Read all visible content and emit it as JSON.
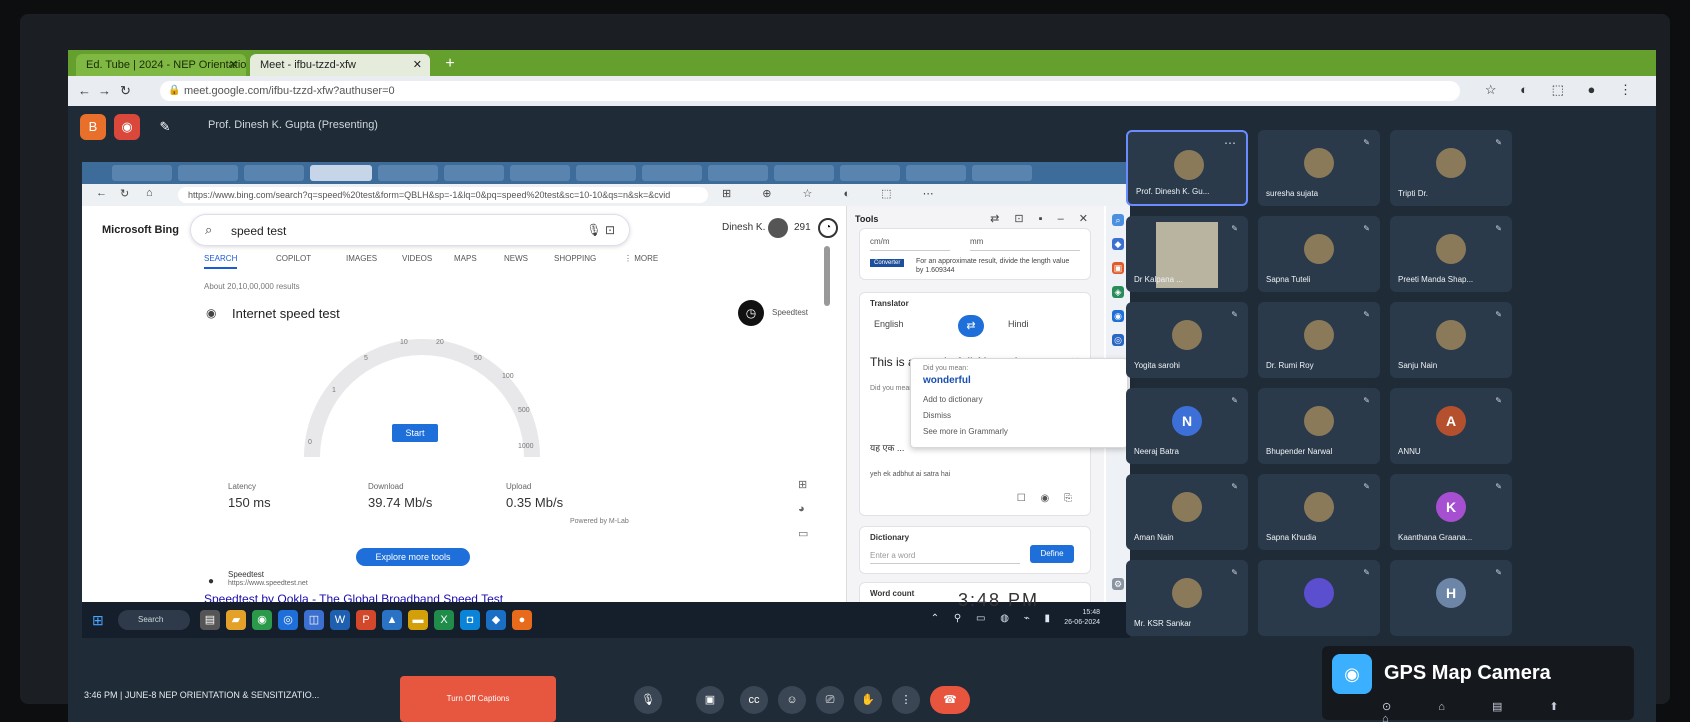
{
  "browser": {
    "tabs": [
      {
        "label": "Ed. Tube | 2024 - NEP Orientation"
      },
      {
        "label": "Meet - ifbu-tzzd-xfw"
      }
    ],
    "url": "meet.google.com/ifbu-tzzd-xfw?authuser=0",
    "new_tab": "+"
  },
  "meet": {
    "presenter_label": "Prof. Dinesh K. Gupta (Presenting)",
    "meeting_info": "3:46 PM  |  JUNE-8 NEP ORIENTATION & SENSITIZATIO...",
    "orange_button": "Turn Off Captions",
    "participants": [
      {
        "name": "Prof. Dinesh K. Gu...",
        "type": "photo"
      },
      {
        "name": "suresha sujata",
        "type": "photo"
      },
      {
        "name": "Tripti Dr.",
        "type": "photo"
      },
      {
        "name": "Dr Kalpana ...",
        "type": "camera"
      },
      {
        "name": "Sapna Tuteli",
        "type": "photo"
      },
      {
        "name": "Preeti Manda Shap...",
        "type": "photo"
      },
      {
        "name": "Yogita sarohi",
        "type": "photo"
      },
      {
        "name": "Dr. Rumi Roy",
        "type": "photo"
      },
      {
        "name": "Sanju Nain",
        "type": "photo"
      },
      {
        "name": "Neeraj Batra",
        "type": "letter",
        "letter": "N",
        "color": "#3c6fd8"
      },
      {
        "name": "Bhupender Narwal",
        "type": "photo"
      },
      {
        "name": "ANNU",
        "type": "letter",
        "letter": "A",
        "color": "#b5502e"
      },
      {
        "name": "Aman Nain",
        "type": "photo"
      },
      {
        "name": "Sapna Khudia",
        "type": "photo"
      },
      {
        "name": "Kaanthana Graana...",
        "type": "letter",
        "letter": "K",
        "color": "#a64fd0"
      },
      {
        "name": "Mr. KSR Sankar",
        "type": "photo"
      },
      {
        "name": "",
        "type": "letter",
        "letter": "",
        "color": "#5b4fd0"
      },
      {
        "name": "",
        "type": "letter",
        "letter": "H",
        "color": "#6d86a8"
      }
    ]
  },
  "shared": {
    "edge_url": "https://www.bing.com/search?q=speed%20test&form=QBLH&sp=-1&lq=0&pq=speed%20test&sc=10-10&qs=n&sk=&cvid",
    "bing": {
      "logo": "Microsoft Bing",
      "query": "speed test",
      "user": "Dinesh K.",
      "points": "291",
      "tabs": [
        "SEARCH",
        "COPILOT",
        "IMAGES",
        "VIDEOS",
        "MAPS",
        "NEWS",
        "SHOPPING",
        "⋮ MORE"
      ],
      "result_count": "About 20,10,00,000 results",
      "widget_title": "Internet speed test",
      "widget_badge": "Speedtest",
      "gauge_ticks": [
        "0",
        "1",
        "5",
        "10",
        "20",
        "50",
        "100",
        "500",
        "1000"
      ],
      "start_label": "Start",
      "latency_label": "Latency",
      "latency_value": "150 ms",
      "download_label": "Download",
      "download_value": "39.74 Mb/s",
      "upload_label": "Upload",
      "upload_value": "0.35 Mb/s",
      "provider": "Powered by M-Lab",
      "explore_label": "Explore more tools",
      "result_site": "Speedtest",
      "result_url": "https://www.speedtest.net",
      "result_title": "Speedtest by Ookla - The Global Broadband Speed Test"
    },
    "tools": {
      "title": "Tools",
      "unit_from": "cm/m",
      "unit_to": "mm",
      "unit_tag": "Converter",
      "unit_note": "For an approximate result, divide the length value by 1.609344",
      "translator_title": "Translator",
      "lang_from": "English",
      "lang_to": "Hindi",
      "source_text": "This is a wonderfull AI session",
      "detect": "Did you mean...",
      "hindi_output": "यह एक ...",
      "translit": "yeh ek adbhut ai satra hai",
      "dictionary_title": "Dictionary",
      "dictionary_placeholder": "Enter a word",
      "define_label": "Define",
      "word_count_title": "Word count"
    },
    "spell_popup": {
      "header": "Did you mean:",
      "suggestion": "wonderful",
      "items": [
        "Add to dictionary",
        "Dismiss",
        "See more in Grammarly"
      ]
    },
    "taskbar": {
      "search": "Search",
      "time": "15:48",
      "date": "26-06-2024"
    },
    "big_clock": "3:48 PM"
  },
  "gps": {
    "label": "GPS Map Camera"
  }
}
